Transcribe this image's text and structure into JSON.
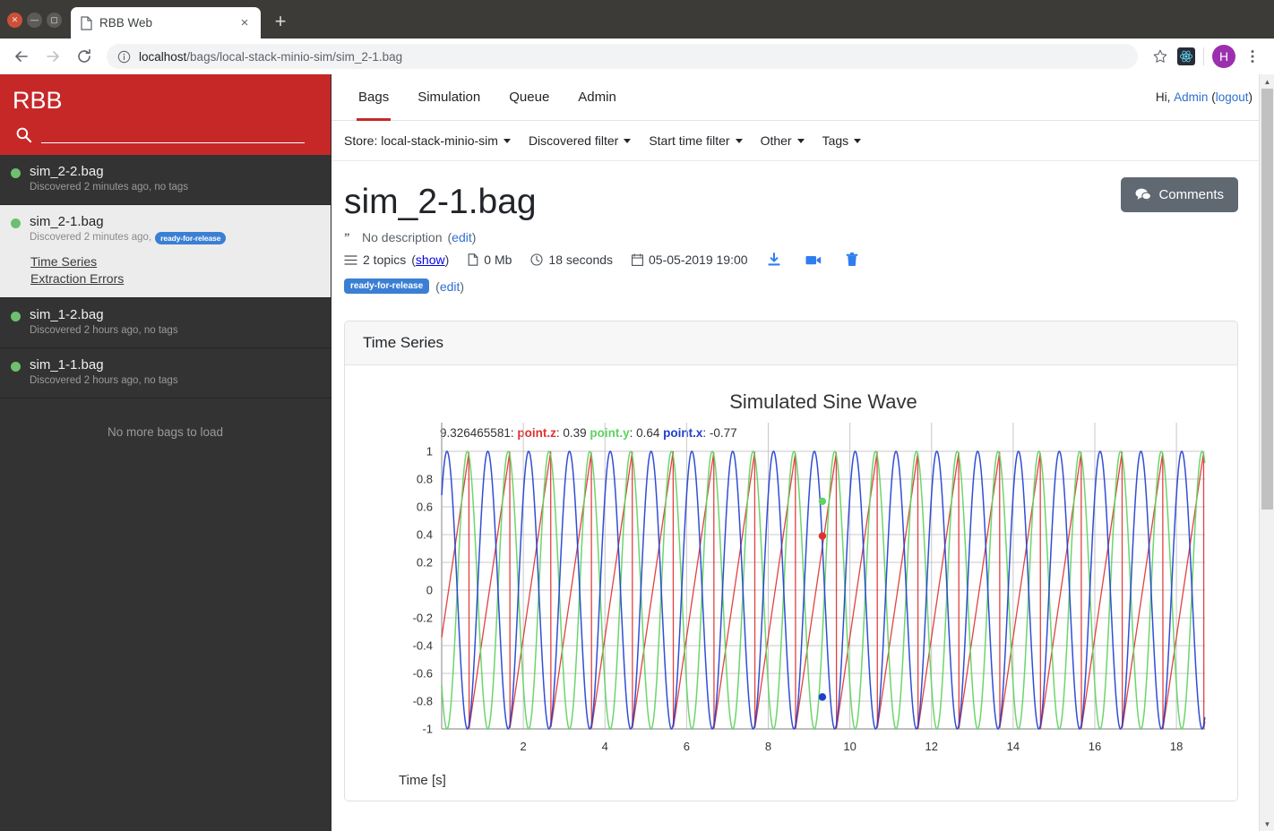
{
  "browser": {
    "window_controls": [
      "close",
      "minimize",
      "maximize"
    ],
    "tab": {
      "title": "RBB Web",
      "favicon": "page-icon",
      "close": "×"
    },
    "new_tab_label": "+",
    "nav": {
      "back": "←",
      "forward": "→",
      "reload": "↻"
    },
    "omnibox": {
      "info_icon": "info-circle-icon",
      "host": "localhost",
      "path": "/bags/local-stack-minio-sim/sim_2-1.bag",
      "full_url": "localhost/bags/local-stack-minio-sim/sim_2-1.bag"
    },
    "star_icon": "bookmark-star-icon",
    "extension_icon": "react-devtools-icon",
    "profile_initial": "H",
    "menu_icon": "three-dot-menu-icon"
  },
  "sidebar": {
    "brand": "RBB",
    "search_placeholder": "",
    "search_value": "",
    "bags": [
      {
        "name": "sim_2-2.bag",
        "discovered": "Discovered 2 minutes ago, no tags",
        "tag": "",
        "selected": false
      },
      {
        "name": "sim_2-1.bag",
        "discovered": "Discovered 2 minutes ago,",
        "tag": "ready-for-release",
        "selected": true,
        "links": [
          "Time Series",
          "Extraction Errors"
        ]
      },
      {
        "name": "sim_1-2.bag",
        "discovered": "Discovered 2 hours ago, no tags",
        "tag": "",
        "selected": false
      },
      {
        "name": "sim_1-1.bag",
        "discovered": "Discovered 2 hours ago, no tags",
        "tag": "",
        "selected": false
      }
    ],
    "empty_message": "No more bags to load"
  },
  "topnav": {
    "tabs": [
      {
        "label": "Bags",
        "active": true
      },
      {
        "label": "Simulation",
        "active": false
      },
      {
        "label": "Queue",
        "active": false
      },
      {
        "label": "Admin",
        "active": false
      }
    ],
    "greeting": "Hi,",
    "user": "Admin",
    "logout_open": "(",
    "logout": "logout",
    "logout_close": ")"
  },
  "filterbar": {
    "items": [
      "Store: local-stack-minio-sim",
      "Discovered filter",
      "Start time filter",
      "Other",
      "Tags"
    ]
  },
  "bag": {
    "title": "sim_2-1.bag",
    "description": "No description",
    "description_edit": "edit",
    "topics": "2 topics",
    "topics_show": "show",
    "size": "0 Mb",
    "duration": "18 seconds",
    "datetime": "05-05-2019 19:00",
    "tag": "ready-for-release",
    "tag_edit": "edit",
    "comments_button": "Comments"
  },
  "panel": {
    "header": "Time Series"
  },
  "chart_data": {
    "type": "line",
    "title": "Simulated Sine Wave",
    "xlabel": "Time [s]",
    "ylabel": "",
    "xlim": [
      0,
      18.7
    ],
    "ylim": [
      -1,
      1
    ],
    "xticks": [
      2,
      4,
      6,
      8,
      10,
      12,
      14,
      16,
      18
    ],
    "yticks": [
      1,
      0.8,
      0.6,
      0.4,
      0.2,
      0,
      -0.2,
      -0.4,
      -0.6,
      -0.8,
      -1
    ],
    "grid": true,
    "legend_position": "none",
    "series": [
      {
        "name": "point.z",
        "color": "#e03131",
        "waveform": "sawtooth",
        "period": 1.0,
        "amplitude": 1.0,
        "offset": 0.0,
        "phase": 0.33
      },
      {
        "name": "point.y",
        "color": "#5fd35f",
        "waveform": "sine",
        "period": 1.0,
        "amplitude": 1.0,
        "offset": 0.0,
        "phase": 0.62
      },
      {
        "name": "point.x",
        "color": "#1f3fd0",
        "waveform": "sine",
        "period": 1.0,
        "amplitude": 1.0,
        "offset": 0.0,
        "phase": 0.12
      }
    ],
    "hover": {
      "x": "9.326465581",
      "x_label": "9.326465581:",
      "entries": [
        {
          "name": "point.z",
          "value": "0.39",
          "color": "#e03131",
          "y": 0.39
        },
        {
          "name": "point.y",
          "value": "0.64",
          "color": "#5fd35f",
          "y": 0.64
        },
        {
          "name": "point.x",
          "value": "-0.77",
          "color": "#1f3fd0",
          "y": -0.77
        }
      ]
    }
  },
  "colors": {
    "brand_red": "#c62828",
    "accent_blue": "#2f6fd0",
    "tag_blue": "#3b7fd4",
    "status_green": "#6ec06e",
    "sidebar_dark": "#333333"
  }
}
